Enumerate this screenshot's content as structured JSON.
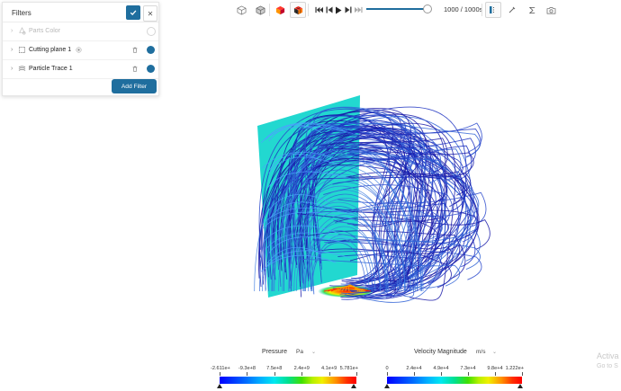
{
  "filters": {
    "title": "Filters",
    "items": [
      {
        "label": "Parts Color",
        "enabled": false
      },
      {
        "label": "Cutting plane 1",
        "enabled": true
      },
      {
        "label": "Particle Trace 1",
        "enabled": true
      }
    ],
    "add_filter_label": "Add Filter"
  },
  "toolbar": {
    "time_readout": "1000 / 1000s",
    "playback_progress": 1.0
  },
  "legends": {
    "pressure": {
      "title": "Pressure",
      "unit": "Pa",
      "ticks": [
        "-2.611e+",
        "-9.3e+8",
        "7.5e+8",
        "2.4e+9",
        "4.1e+9",
        "5.781e+"
      ]
    },
    "velocity": {
      "title": "Velocity Magnitude",
      "unit": "m/s",
      "ticks": [
        "0",
        "2.4e+4",
        "4.9e+4",
        "7.3e+4",
        "9.8e+4",
        "1.222e+"
      ]
    }
  },
  "watermark": {
    "line1": "Activa",
    "line2": "Go to S"
  },
  "colors": {
    "accent": "#1f6e9e",
    "plane": "#22d8d0",
    "trace_dark": "#1a1aa8",
    "trace_mid": "#2f62d6",
    "trace_hot": "#ff2a00"
  }
}
